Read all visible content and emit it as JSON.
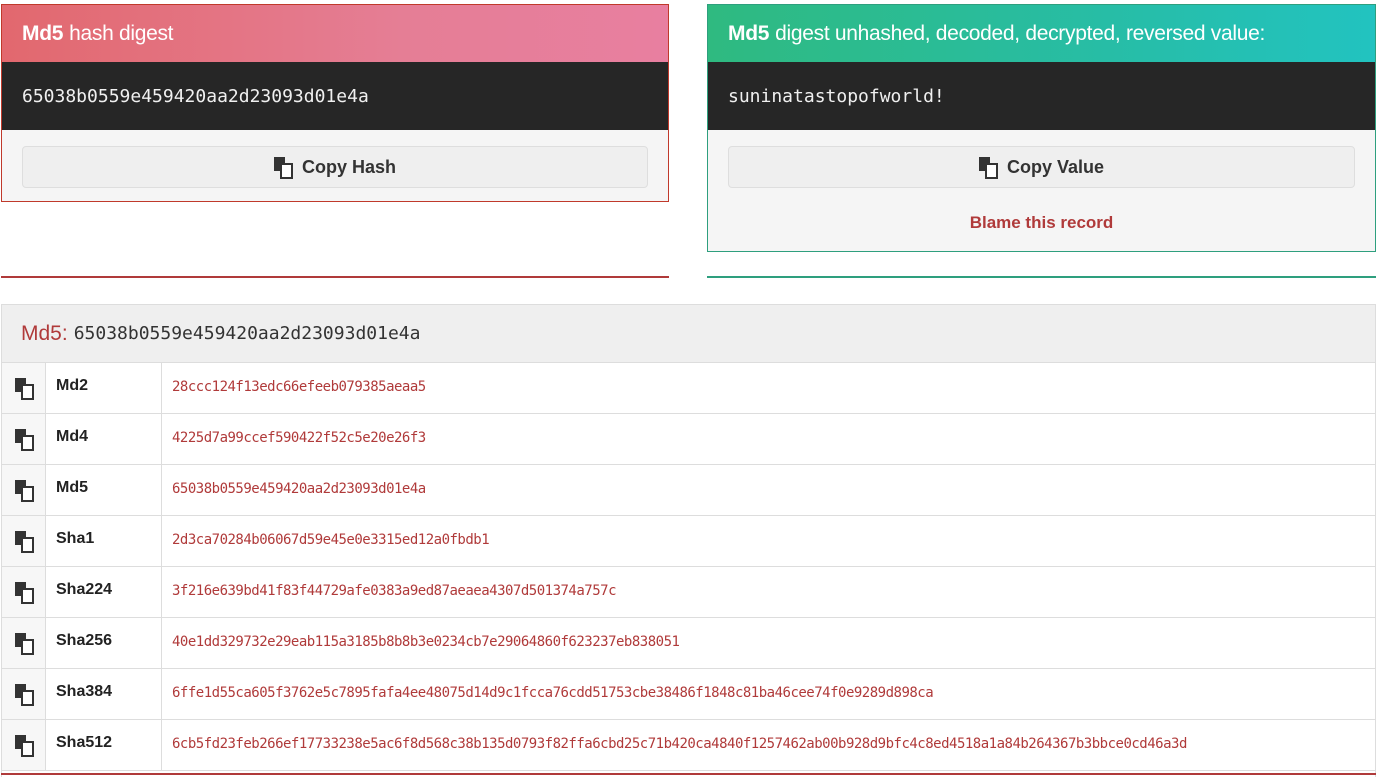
{
  "left_card": {
    "title_bold": "Md5",
    "title_rest": "hash digest",
    "hash": "65038b0559e459420aa2d23093d01e4a",
    "copy_label": "Copy Hash"
  },
  "right_card": {
    "title_bold": "Md5",
    "title_rest": "digest unhashed, decoded, decrypted, reversed value:",
    "value": "suninatastopofworld!",
    "copy_label": "Copy Value",
    "blame_label": "Blame this record"
  },
  "table": {
    "head_label": "Md5:",
    "head_value": "65038b0559e459420aa2d23093d01e4a",
    "rows": [
      {
        "name": "Md2",
        "hash": "28ccc124f13edc66efeeb079385aeaa5"
      },
      {
        "name": "Md4",
        "hash": "4225d7a99ccef590422f52c5e20e26f3"
      },
      {
        "name": "Md5",
        "hash": "65038b0559e459420aa2d23093d01e4a"
      },
      {
        "name": "Sha1",
        "hash": "2d3ca70284b06067d59e45e0e3315ed12a0fbdb1"
      },
      {
        "name": "Sha224",
        "hash": "3f216e639bd41f83f44729afe0383a9ed87aeaea4307d501374a757c"
      },
      {
        "name": "Sha256",
        "hash": "40e1dd329732e29eab115a3185b8b8b3e0234cb7e29064860f623237eb838051"
      },
      {
        "name": "Sha384",
        "hash": "6ffe1d55ca605f3762e5c7895fafa4ee48075d14d9c1fcca76cdd51753cbe38486f1848c81ba46cee74f0e9289d898ca"
      },
      {
        "name": "Sha512",
        "hash": "6cb5fd23feb266ef17733238e5ac6f8d568c38b135d0793f82ffa6cbd25c71b420ca4840f1257462ab00b928d9bfc4c8ed4518a1a84b264367b3bbce0cd46a3d"
      }
    ]
  },
  "icons": {
    "copy": "copy-icon"
  },
  "colors": {
    "left_accent": "#c0392b",
    "right_accent": "#2e9f7e",
    "hash_text": "#b03a3a"
  }
}
